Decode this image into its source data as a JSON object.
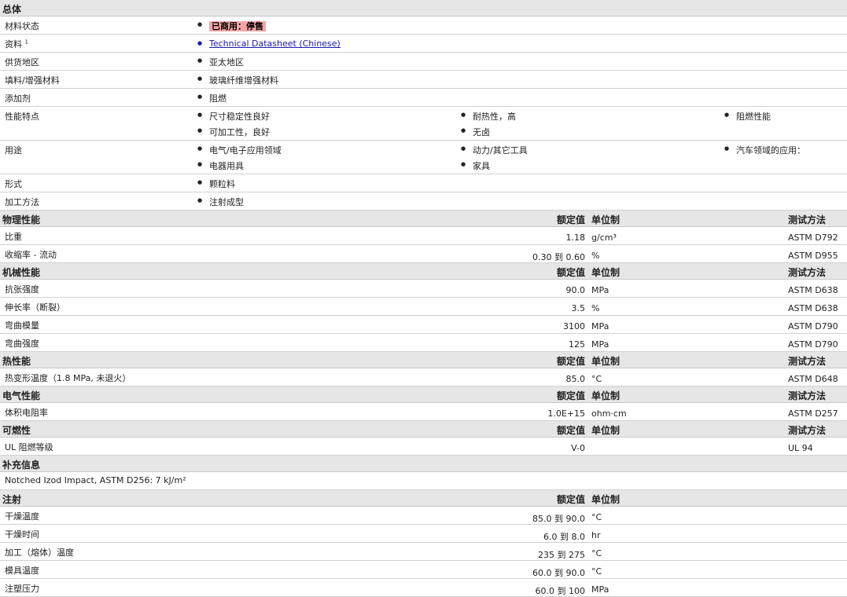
{
  "general": {
    "title": "总体",
    "rows": [
      {
        "label": "材料状态",
        "items": [
          "已商用：停售"
        ]
      },
      {
        "label": "资料",
        "sup": "1",
        "items": [
          "Technical Datasheet (Chinese)"
        ]
      },
      {
        "label": "供货地区",
        "items": [
          "亚太地区"
        ]
      },
      {
        "label": "填料/增强材料",
        "items": [
          "玻璃纤维增强材料"
        ]
      },
      {
        "label": "添加剂",
        "items": [
          "阻燃"
        ]
      },
      {
        "label": "性能特点",
        "items": [
          "尺寸稳定性良好",
          "耐热性，高",
          "阻燃性能",
          "可加工性，良好",
          "无卤"
        ]
      },
      {
        "label": "用途",
        "items": [
          "电气/电子应用领域",
          "动力/其它工具",
          "汽车领域的应用：",
          "电器用具",
          "家具"
        ]
      },
      {
        "label": "形式",
        "items": [
          "颗粒料"
        ]
      },
      {
        "label": "加工方法",
        "items": [
          "注射成型"
        ]
      }
    ]
  },
  "col_headers": {
    "nominal": "额定值",
    "unit": "单位制",
    "method": "测试方法"
  },
  "physical": {
    "title": "物理性能",
    "rows": [
      {
        "label": "比重",
        "value": "1.18",
        "unit": "g/cm³",
        "method": "ASTM D792"
      },
      {
        "label": "收缩率 - 流动",
        "value": "0.30 到  0.60",
        "unit": "%",
        "method": "ASTM D955"
      }
    ]
  },
  "mechanical": {
    "title": "机械性能",
    "rows": [
      {
        "label": "抗张强度",
        "value": "90.0",
        "unit": "MPa",
        "method": "ASTM D638"
      },
      {
        "label": "伸长率（断裂）",
        "value": "3.5",
        "unit": "%",
        "method": "ASTM D638"
      },
      {
        "label": "弯曲模量",
        "value": "3100",
        "unit": "MPa",
        "method": "ASTM D790"
      },
      {
        "label": "弯曲强度",
        "value": "125",
        "unit": "MPa",
        "method": "ASTM D790"
      }
    ]
  },
  "thermal": {
    "title": "热性能",
    "rows": [
      {
        "label": "热变形温度（1.8 MPa, 未退火）",
        "value": "85.0",
        "unit": "°C",
        "method": "ASTM D648"
      }
    ]
  },
  "electrical": {
    "title": "电气性能",
    "rows": [
      {
        "label": "体积电阻率",
        "value": "1.0E+15",
        "unit": "ohm·cm",
        "method": "ASTM D257"
      }
    ]
  },
  "flammability": {
    "title": "可燃性",
    "rows": [
      {
        "label": "UL 阻燃等级",
        "value": "V-0",
        "unit": "",
        "method": "UL 94"
      }
    ]
  },
  "supplementary": {
    "title": "补充信息",
    "text": "Notched Izod Impact, ASTM D256: 7 kJ/m²"
  },
  "injection": {
    "title": "注射",
    "rows": [
      {
        "label": "干燥温度",
        "value": "85.0 到  90.0",
        "unit": "°C"
      },
      {
        "label": "干燥时间",
        "value": "6.0 到  8.0",
        "unit": "hr"
      },
      {
        "label": "加工（熔体）温度",
        "value": "235 到  275",
        "unit": "°C"
      },
      {
        "label": "模具温度",
        "value": "60.0 到  90.0",
        "unit": "°C"
      },
      {
        "label": "注塑压力",
        "value": "60.0 到  100",
        "unit": "MPa"
      }
    ]
  }
}
